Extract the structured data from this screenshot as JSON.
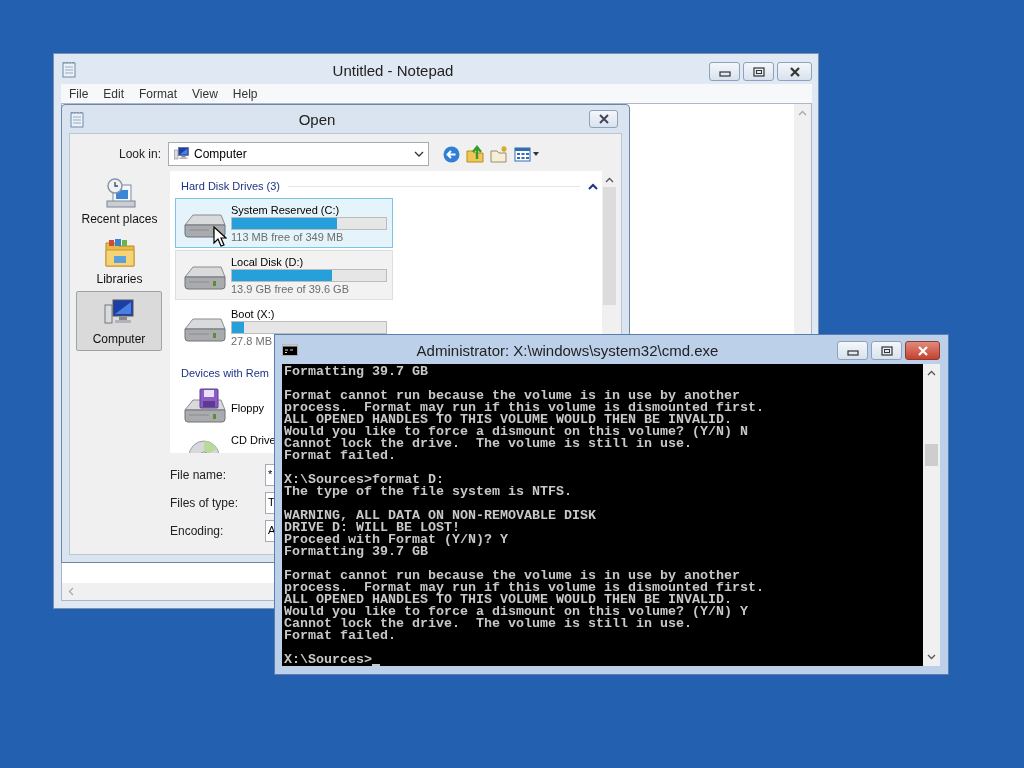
{
  "notepad": {
    "title": "Untitled - Notepad",
    "menu": [
      "File",
      "Edit",
      "Format",
      "View",
      "Help"
    ]
  },
  "open_dialog": {
    "title": "Open",
    "look_in": {
      "label": "Look in:",
      "value": "Computer"
    },
    "places": [
      {
        "label": "Recent places",
        "kind": "recent",
        "selected": false
      },
      {
        "label": "Libraries",
        "kind": "libraries",
        "selected": false
      },
      {
        "label": "Computer",
        "kind": "computer",
        "selected": true
      }
    ],
    "groups": [
      {
        "title": "Hard Disk Drives (3)",
        "expanded": true,
        "items": [
          {
            "kind": "drive",
            "name": "System Reserved (C:)",
            "level": 0.68,
            "free": "113 MB free of 349 MB",
            "selected": true,
            "focused": false
          },
          {
            "kind": "drive",
            "name": "Local Disk (D:)",
            "level": 0.65,
            "free": "13.9 GB free of 39.6 GB",
            "selected": false,
            "focused": true
          },
          {
            "kind": "drive",
            "name": "Boot (X:)",
            "level": 0.08,
            "free": "27.8 MB",
            "selected": false,
            "focused": false
          }
        ]
      },
      {
        "title": "Devices with Rem",
        "items": [
          {
            "kind": "floppy",
            "name": "Floppy",
            "selected": false,
            "focused": false
          },
          {
            "kind": "cd",
            "name": "CD Drive",
            "selected": false,
            "focused": false
          }
        ]
      }
    ],
    "fields": [
      {
        "label": "File name:",
        "value": "*"
      },
      {
        "label": "Files of type:",
        "value": "T"
      },
      {
        "label": "Encoding:",
        "value": "A"
      }
    ]
  },
  "cmd": {
    "title": "Administrator: X:\\windows\\system32\\cmd.exe",
    "console": {
      "cursor": true,
      "blocks": [
        [
          "Formatting 39.7 GB"
        ],
        [
          "Format cannot run because the volume is in use by another",
          "process.  Format may run if this volume is dismounted first.",
          "ALL OPENED HANDLES TO THIS VOLUME WOULD THEN BE INVALID.",
          "Would you like to force a dismount on this volume? (Y/N) N",
          "Cannot lock the drive.  The volume is still in use.",
          "Format failed."
        ],
        [
          "X:\\Sources>format D:",
          "The type of the file system is NTFS."
        ],
        [
          "WARNING, ALL DATA ON NON-REMOVABLE DISK",
          "DRIVE D: WILL BE LOST!",
          "Proceed with Format (Y/N)? Y",
          "Formatting 39.7 GB"
        ],
        [
          "Format cannot run because the volume is in use by another",
          "process.  Format may run if this volume is dismounted first.",
          "ALL OPENED HANDLES TO THIS VOLUME WOULD THEN BE INVALID.",
          "Would you like to force a dismount on this volume? (Y/N) Y",
          "Cannot lock the drive.  The volume is still in use.",
          "Format failed."
        ],
        [
          "X:\\Sources>"
        ]
      ]
    }
  }
}
